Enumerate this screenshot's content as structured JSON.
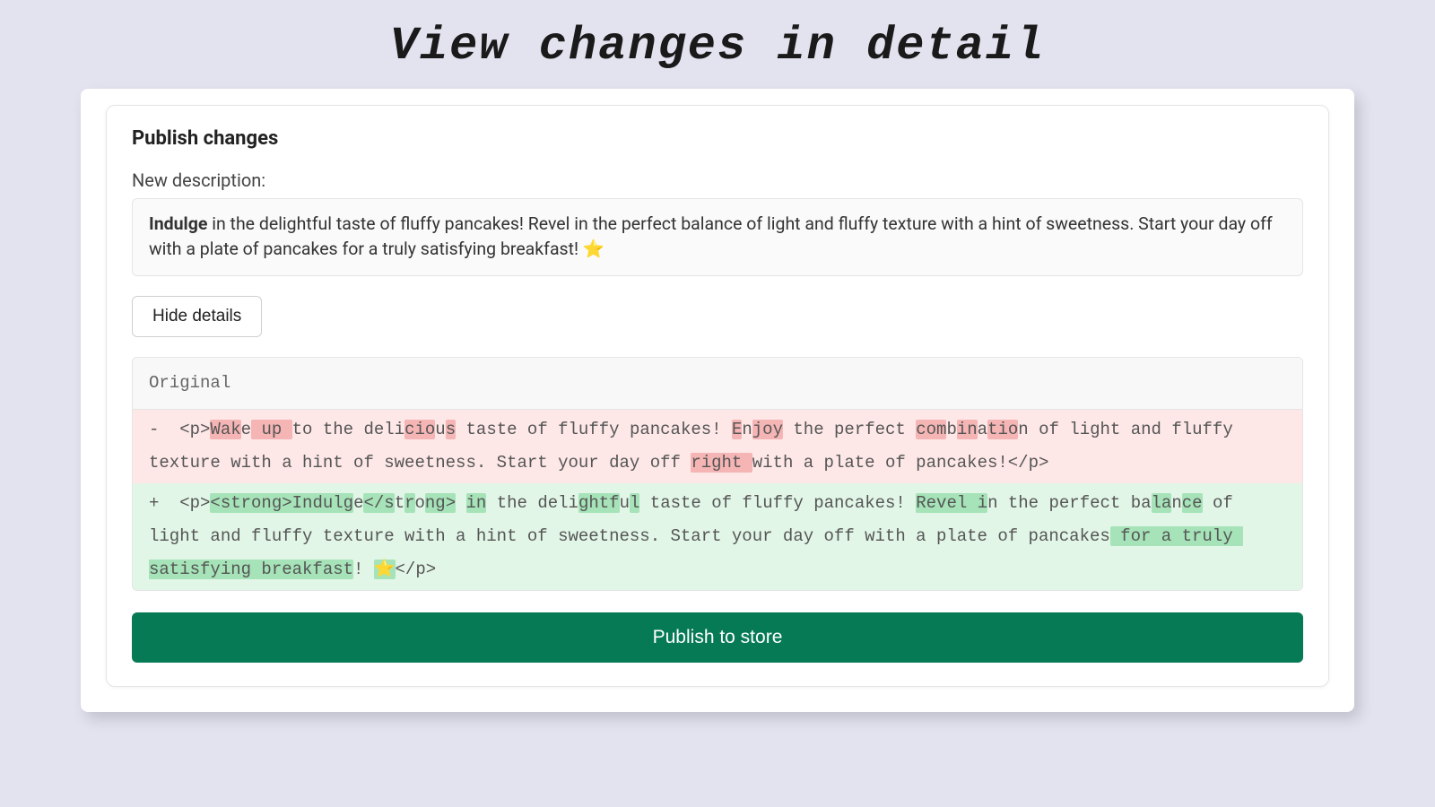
{
  "page": {
    "title": "View changes in detail"
  },
  "card": {
    "section_title": "Publish changes",
    "field_label": "New description:",
    "description_strong": "Indulge",
    "description_rest": " in the delightful taste of fluffy pancakes! Revel in the perfect balance of light and fluffy texture with a hint of sweetness. Start your day off with a plate of pancakes for a truly satisfying breakfast! ⭐",
    "details_button": "Hide details",
    "publish_button": "Publish to store"
  },
  "diff": {
    "header": "Original",
    "removed_segments": [
      {
        "t": "-  <p>",
        "h": false
      },
      {
        "t": "Wak",
        "h": true
      },
      {
        "t": "e",
        "h": false
      },
      {
        "t": " up ",
        "h": true
      },
      {
        "t": "to the deli",
        "h": false
      },
      {
        "t": "cio",
        "h": true
      },
      {
        "t": "u",
        "h": false
      },
      {
        "t": "s",
        "h": true
      },
      {
        "t": " taste of fluffy pancakes! ",
        "h": false
      },
      {
        "t": "E",
        "h": true
      },
      {
        "t": "n",
        "h": false
      },
      {
        "t": "joy",
        "h": true
      },
      {
        "t": " the perfect ",
        "h": false
      },
      {
        "t": "com",
        "h": true
      },
      {
        "t": "b",
        "h": false
      },
      {
        "t": "in",
        "h": true
      },
      {
        "t": "a",
        "h": false
      },
      {
        "t": "tio",
        "h": true
      },
      {
        "t": "n of light and fluffy texture with a hint of sweetness. Start your day off ",
        "h": false
      },
      {
        "t": "right ",
        "h": true
      },
      {
        "t": "with a plate of pancakes!</p>",
        "h": false
      }
    ],
    "added_segments": [
      {
        "t": "+  <p>",
        "h": false
      },
      {
        "t": "<strong>Indulg",
        "h": true
      },
      {
        "t": "e",
        "h": false
      },
      {
        "t": "</s",
        "h": true
      },
      {
        "t": "t",
        "h": false
      },
      {
        "t": "r",
        "h": true
      },
      {
        "t": "o",
        "h": false
      },
      {
        "t": "ng>",
        "h": true
      },
      {
        "t": " ",
        "h": false
      },
      {
        "t": "in",
        "h": true
      },
      {
        "t": " the deli",
        "h": false
      },
      {
        "t": "ghtf",
        "h": true
      },
      {
        "t": "u",
        "h": false
      },
      {
        "t": "l",
        "h": true
      },
      {
        "t": " taste of fluffy pancakes! ",
        "h": false
      },
      {
        "t": "Revel i",
        "h": true
      },
      {
        "t": "n the perfect ba",
        "h": false
      },
      {
        "t": "la",
        "h": true
      },
      {
        "t": "n",
        "h": false
      },
      {
        "t": "ce",
        "h": true
      },
      {
        "t": " of light and fluffy texture with a hint of sweetness. Start your day off with a plate of pancakes",
        "h": false
      },
      {
        "t": " for a truly satisfying breakfast",
        "h": true
      },
      {
        "t": "! ",
        "h": false
      },
      {
        "t": "⭐",
        "h": true
      },
      {
        "t": "</p>",
        "h": false
      }
    ]
  }
}
